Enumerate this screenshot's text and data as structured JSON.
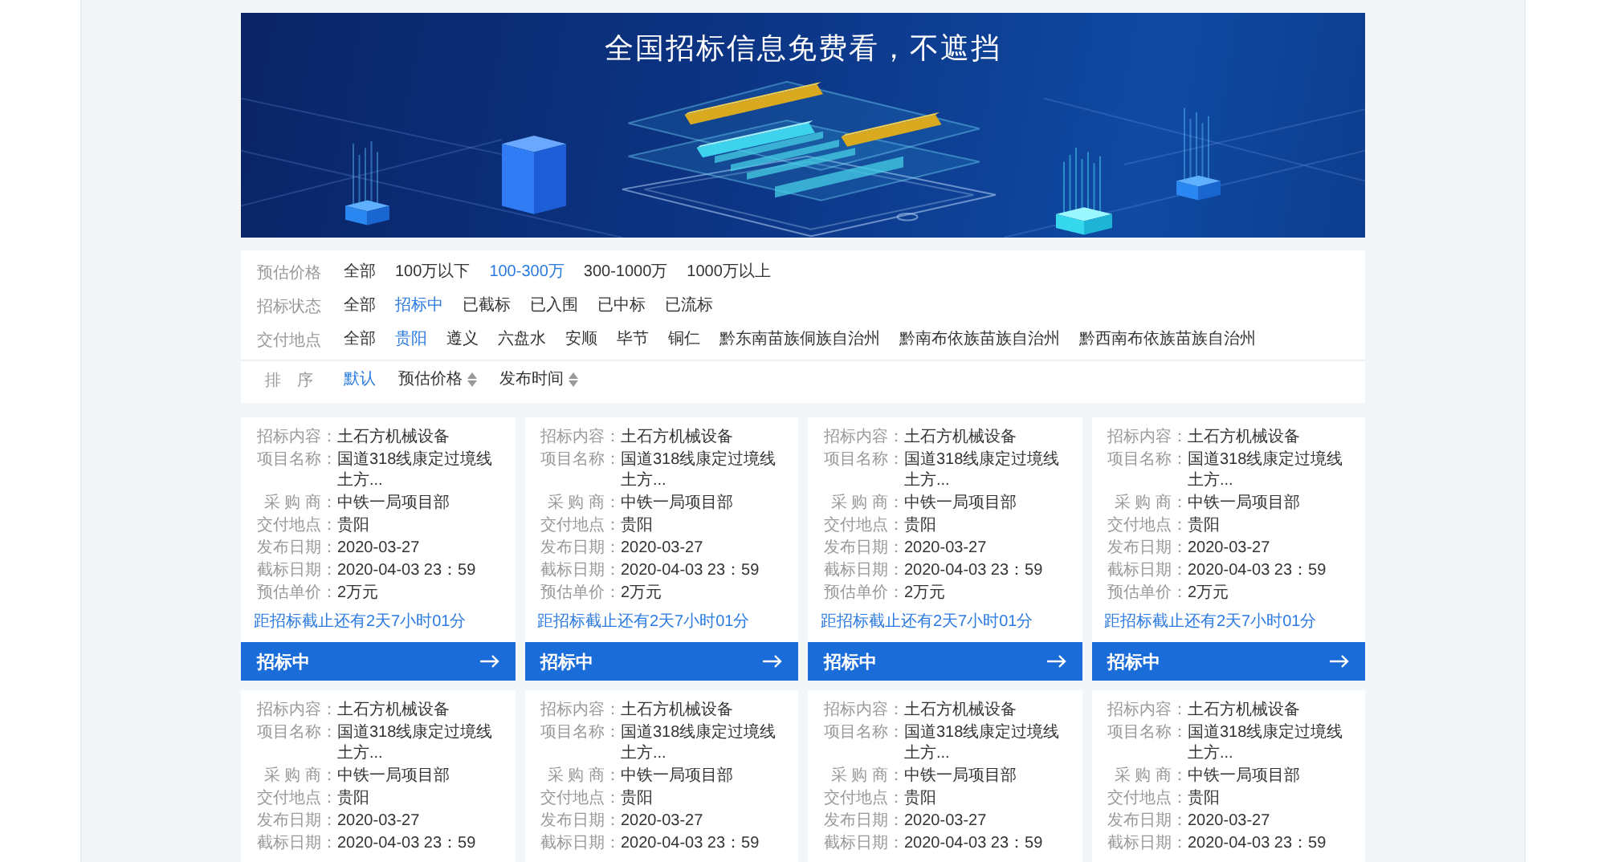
{
  "banner": {
    "title": "全国招标信息免费看，不遮挡"
  },
  "filters": [
    {
      "label": "预估价格",
      "options": [
        {
          "text": "全部",
          "selected": false
        },
        {
          "text": "100万以下",
          "selected": false
        },
        {
          "text": "100-300万",
          "selected": true
        },
        {
          "text": "300-1000万",
          "selected": false
        },
        {
          "text": "1000万以上",
          "selected": false
        }
      ]
    },
    {
      "label": "招标状态",
      "options": [
        {
          "text": "全部",
          "selected": false
        },
        {
          "text": "招标中",
          "selected": true
        },
        {
          "text": "已截标",
          "selected": false
        },
        {
          "text": "已入围",
          "selected": false
        },
        {
          "text": "已中标",
          "selected": false
        },
        {
          "text": "已流标",
          "selected": false
        }
      ]
    },
    {
      "label": "交付地点",
      "options": [
        {
          "text": "全部",
          "selected": false
        },
        {
          "text": "贵阳",
          "selected": true
        },
        {
          "text": "遵义",
          "selected": false
        },
        {
          "text": "六盘水",
          "selected": false
        },
        {
          "text": "安顺",
          "selected": false
        },
        {
          "text": "毕节",
          "selected": false
        },
        {
          "text": "铜仁",
          "selected": false
        },
        {
          "text": "黔东南苗族侗族自治州",
          "selected": false
        },
        {
          "text": "黔南布依族苗族自治州",
          "selected": false
        },
        {
          "text": "黔西南布依族苗族自治州",
          "selected": false
        }
      ]
    }
  ],
  "sort": {
    "label": "排　序",
    "options": [
      {
        "text": "默认",
        "selected": true,
        "kind": "plain"
      },
      {
        "text": "预估价格",
        "selected": false,
        "kind": "sortable"
      },
      {
        "text": "发布时间",
        "selected": false,
        "kind": "sortable"
      }
    ]
  },
  "cards": [
    {
      "fields": [
        {
          "label": "招标内容：",
          "value": "土石方机械设备"
        },
        {
          "label": "项目名称：",
          "value": "国道318线康定过境线土方..."
        },
        {
          "label": "采 购 商：",
          "value": "中铁一局项目部"
        },
        {
          "label": "交付地点：",
          "value": "贵阳"
        },
        {
          "label": "发布日期：",
          "value": "2020-03-27"
        },
        {
          "label": "截标日期：",
          "value": "2020-04-03 23：59"
        },
        {
          "label": "预估单价：",
          "value": "2万元"
        }
      ],
      "countdown": "距招标截止还有2天7小时01分",
      "button": "招标中"
    },
    {
      "fields": [
        {
          "label": "招标内容：",
          "value": "土石方机械设备"
        },
        {
          "label": "项目名称：",
          "value": "国道318线康定过境线土方..."
        },
        {
          "label": "采 购 商：",
          "value": "中铁一局项目部"
        },
        {
          "label": "交付地点：",
          "value": "贵阳"
        },
        {
          "label": "发布日期：",
          "value": "2020-03-27"
        },
        {
          "label": "截标日期：",
          "value": "2020-04-03 23：59"
        },
        {
          "label": "预估单价：",
          "value": "2万元"
        }
      ],
      "countdown": "距招标截止还有2天7小时01分",
      "button": "招标中"
    },
    {
      "fields": [
        {
          "label": "招标内容：",
          "value": "土石方机械设备"
        },
        {
          "label": "项目名称：",
          "value": "国道318线康定过境线土方..."
        },
        {
          "label": "采 购 商：",
          "value": "中铁一局项目部"
        },
        {
          "label": "交付地点：",
          "value": "贵阳"
        },
        {
          "label": "发布日期：",
          "value": "2020-03-27"
        },
        {
          "label": "截标日期：",
          "value": "2020-04-03 23：59"
        },
        {
          "label": "预估单价：",
          "value": "2万元"
        }
      ],
      "countdown": "距招标截止还有2天7小时01分",
      "button": "招标中"
    },
    {
      "fields": [
        {
          "label": "招标内容：",
          "value": "土石方机械设备"
        },
        {
          "label": "项目名称：",
          "value": "国道318线康定过境线土方..."
        },
        {
          "label": "采 购 商：",
          "value": "中铁一局项目部"
        },
        {
          "label": "交付地点：",
          "value": "贵阳"
        },
        {
          "label": "发布日期：",
          "value": "2020-03-27"
        },
        {
          "label": "截标日期：",
          "value": "2020-04-03 23：59"
        },
        {
          "label": "预估单价：",
          "value": "2万元"
        }
      ],
      "countdown": "距招标截止还有2天7小时01分",
      "button": "招标中"
    },
    {
      "fields": [
        {
          "label": "招标内容：",
          "value": "土石方机械设备"
        },
        {
          "label": "项目名称：",
          "value": "国道318线康定过境线土方..."
        },
        {
          "label": "采 购 商：",
          "value": "中铁一局项目部"
        },
        {
          "label": "交付地点：",
          "value": "贵阳"
        },
        {
          "label": "发布日期：",
          "value": "2020-03-27"
        },
        {
          "label": "截标日期：",
          "value": "2020-04-03 23：59"
        }
      ]
    },
    {
      "fields": [
        {
          "label": "招标内容：",
          "value": "土石方机械设备"
        },
        {
          "label": "项目名称：",
          "value": "国道318线康定过境线土方..."
        },
        {
          "label": "采 购 商：",
          "value": "中铁一局项目部"
        },
        {
          "label": "交付地点：",
          "value": "贵阳"
        },
        {
          "label": "发布日期：",
          "value": "2020-03-27"
        },
        {
          "label": "截标日期：",
          "value": "2020-04-03 23：59"
        }
      ]
    },
    {
      "fields": [
        {
          "label": "招标内容：",
          "value": "土石方机械设备"
        },
        {
          "label": "项目名称：",
          "value": "国道318线康定过境线土方..."
        },
        {
          "label": "采 购 商：",
          "value": "中铁一局项目部"
        },
        {
          "label": "交付地点：",
          "value": "贵阳"
        },
        {
          "label": "发布日期：",
          "value": "2020-03-27"
        },
        {
          "label": "截标日期：",
          "value": "2020-04-03 23：59"
        }
      ]
    },
    {
      "fields": [
        {
          "label": "招标内容：",
          "value": "土石方机械设备"
        },
        {
          "label": "项目名称：",
          "value": "国道318线康定过境线土方..."
        },
        {
          "label": "采 购 商：",
          "value": "中铁一局项目部"
        },
        {
          "label": "交付地点：",
          "value": "贵阳"
        },
        {
          "label": "发布日期：",
          "value": "2020-03-27"
        },
        {
          "label": "截标日期：",
          "value": "2020-04-03 23：59"
        }
      ]
    }
  ]
}
